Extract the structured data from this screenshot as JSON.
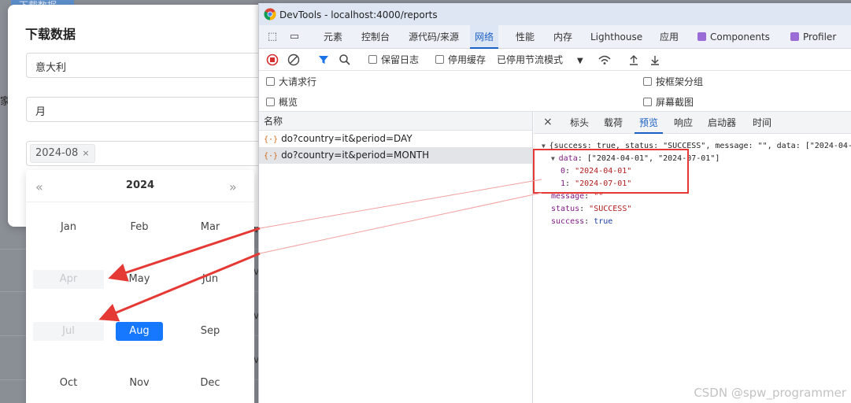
{
  "background": {
    "top_button": "下载数据",
    "cut_label": "家",
    "row_letter": "M"
  },
  "modal": {
    "title": "下载数据",
    "country_value": "意大利",
    "period_value": "月",
    "selected_tag": "2024-08",
    "tag_close": "×"
  },
  "picker": {
    "prev": "«",
    "next": "»",
    "year": "2024",
    "months": [
      {
        "label": "Jan",
        "state": "normal"
      },
      {
        "label": "Feb",
        "state": "normal"
      },
      {
        "label": "Mar",
        "state": "normal"
      },
      {
        "label": "Apr",
        "state": "disabled"
      },
      {
        "label": "May",
        "state": "normal"
      },
      {
        "label": "Jun",
        "state": "normal"
      },
      {
        "label": "Jul",
        "state": "disabled"
      },
      {
        "label": "Aug",
        "state": "selected"
      },
      {
        "label": "Sep",
        "state": "normal"
      },
      {
        "label": "Oct",
        "state": "normal"
      },
      {
        "label": "Nov",
        "state": "normal"
      },
      {
        "label": "Dec",
        "state": "normal"
      }
    ]
  },
  "devtools": {
    "title": "DevTools - localhost:4000/reports",
    "tabs": [
      {
        "label": "元素"
      },
      {
        "label": "控制台"
      },
      {
        "label": "源代码/来源"
      },
      {
        "label": "网络"
      },
      {
        "label": "性能"
      },
      {
        "label": "内存"
      },
      {
        "label": "Lighthouse"
      },
      {
        "label": "应用"
      },
      {
        "label": "Components"
      },
      {
        "label": "Profiler"
      }
    ],
    "active_tab": "网络",
    "toolbar": {
      "preserve_log": "保留日志",
      "disable_cache": "停用缓存",
      "throttle": "已停用节流模式"
    },
    "filters": {
      "big_rows": "大请求行",
      "group_by_frame": "按框架分组",
      "overview": "概览",
      "screenshots": "屏幕截图"
    },
    "name_header": "名称",
    "requests": [
      {
        "icon": "{·}",
        "name": "do?country=it&period=DAY"
      },
      {
        "icon": "{·}",
        "name": "do?country=it&period=MONTH"
      }
    ],
    "preview_tabs": [
      "标头",
      "载荷",
      "预览",
      "响应",
      "启动器",
      "时间"
    ],
    "preview_close": "×",
    "json": {
      "summary": "{success: true, status: \"SUCCESS\", message: \"\", data: [\"2024-04-",
      "data_summary": "[\"2024-04-01\", \"2024-07-01\"]",
      "data_items": [
        "\"2024-04-01\"",
        "\"2024-07-01\""
      ],
      "message": "\"\"",
      "status": "\"SUCCESS\"",
      "success": "true",
      "keys": {
        "data": "data",
        "message": "message",
        "status": "status",
        "success": "success",
        "i0": "0",
        "i1": "1"
      }
    }
  },
  "watermark": "CSDN @spw_programmer",
  "colors": {
    "accent": "#1677ff",
    "devtools_active": "#1a5fc5",
    "annotation": "#e53935"
  }
}
